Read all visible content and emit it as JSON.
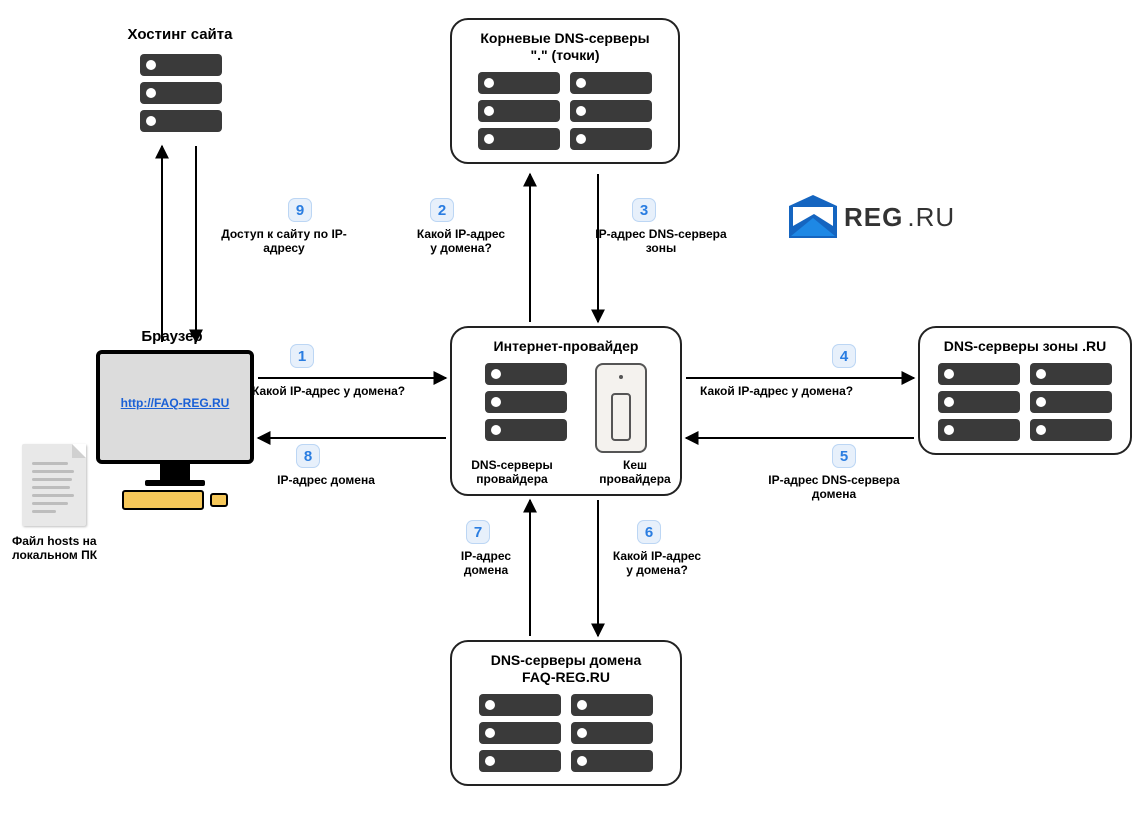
{
  "nodes": {
    "hosting": {
      "title": "Хостинг сайта"
    },
    "root_dns": {
      "title": "Корневые DNS-серверы\n\".\" (точки)"
    },
    "browser": {
      "title": "Браузер",
      "url": "http://FAQ-REG.RU"
    },
    "isp": {
      "title": "Интернет-провайдер",
      "dns_label": "DNS-серверы\nпровайдера",
      "cache_label": "Кеш\nпровайдера"
    },
    "zone_ru": {
      "title": "DNS-серверы зоны .RU"
    },
    "domain_dns": {
      "title": "DNS-серверы домена\nFAQ-REG.RU"
    },
    "hosts_file": {
      "caption": "Файл hosts на\nлокальном ПК"
    }
  },
  "steps": {
    "1": {
      "text": "Какой IP-адрес у домена?"
    },
    "2": {
      "text": "Какой IP-адрес\nу домена?"
    },
    "3": {
      "text": "IP-адрес DNS-сервера\nзоны"
    },
    "4": {
      "text": "Какой IP-адрес у домена?"
    },
    "5": {
      "text": "IP-адрес DNS-сервера\nдомена"
    },
    "6": {
      "text": "Какой IP-адрес\nу домена?"
    },
    "7": {
      "text": "IP-адрес\nдомена"
    },
    "8": {
      "text": "IP-адрес домена"
    },
    "9": {
      "text": "Доступ к сайту по IP-\nадресу"
    }
  },
  "logo": {
    "brand": "REG",
    "tld": ".RU"
  }
}
